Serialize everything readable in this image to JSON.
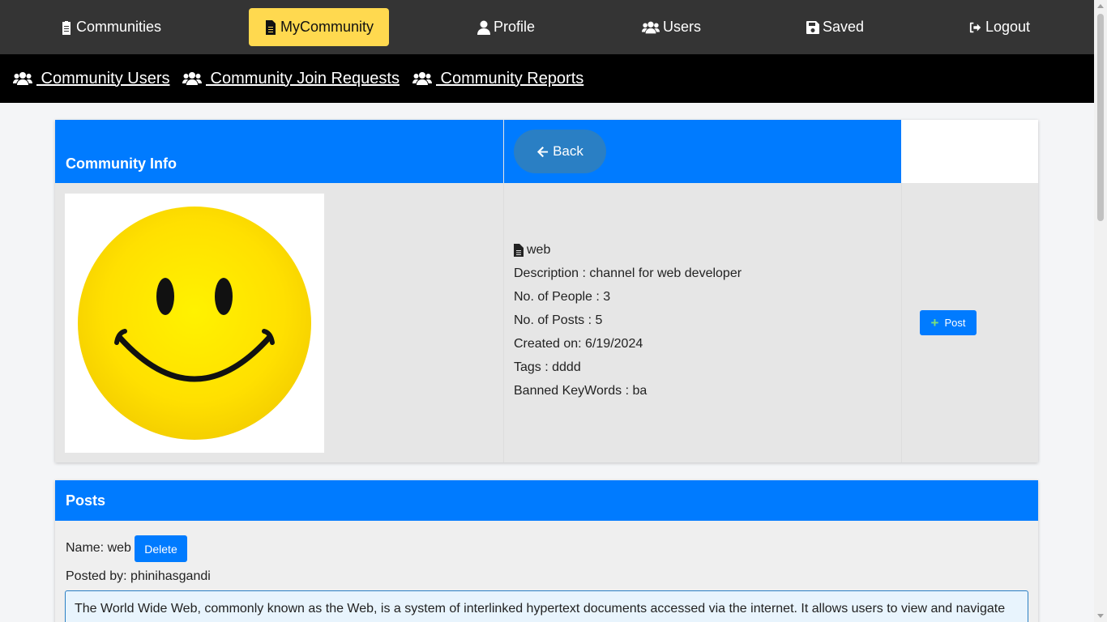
{
  "topnav": {
    "items": [
      {
        "label": "Communities",
        "icon": "clipboard-icon",
        "active": false
      },
      {
        "label": "MyCommunity",
        "icon": "file-icon",
        "active": true
      },
      {
        "label": "Profile",
        "icon": "user-icon",
        "active": false
      },
      {
        "label": "Users",
        "icon": "users-icon",
        "active": false
      },
      {
        "label": "Saved",
        "icon": "save-icon",
        "active": false
      },
      {
        "label": "Logout",
        "icon": "logout-icon",
        "active": false
      }
    ],
    "active_color": "#ffd94f",
    "background": "#343434"
  },
  "subnav": {
    "items": [
      {
        "label": " Community Users",
        "icon": "users-icon"
      },
      {
        "label": " Community Join Requests",
        "icon": "users-icon"
      },
      {
        "label": " Community Reports",
        "icon": "users-icon"
      }
    ]
  },
  "community_info": {
    "title": "Community Info",
    "back_label": "Back",
    "image_icon": "smiley-face-icon",
    "name": "web",
    "description": "Description : channel for web developer",
    "people": "No. of People : 3",
    "posts": "No. of Posts : 5",
    "created": "Created on: 6/19/2024",
    "tags": "Tags : dddd",
    "banned": "Banned KeyWords : ba",
    "post_button_label": "Post"
  },
  "posts": {
    "title": "Posts",
    "items": [
      {
        "name": "Name: web",
        "delete_label": "Delete",
        "posted_by": "Posted by: phinihasgandi",
        "body": "The World Wide Web, commonly known as the Web, is a system of interlinked hypertext documents accessed via the internet. It allows users to view and navigate"
      }
    ]
  },
  "colors": {
    "accent": "#007bff",
    "header_dark": "#343434",
    "subnav": "#000000"
  }
}
